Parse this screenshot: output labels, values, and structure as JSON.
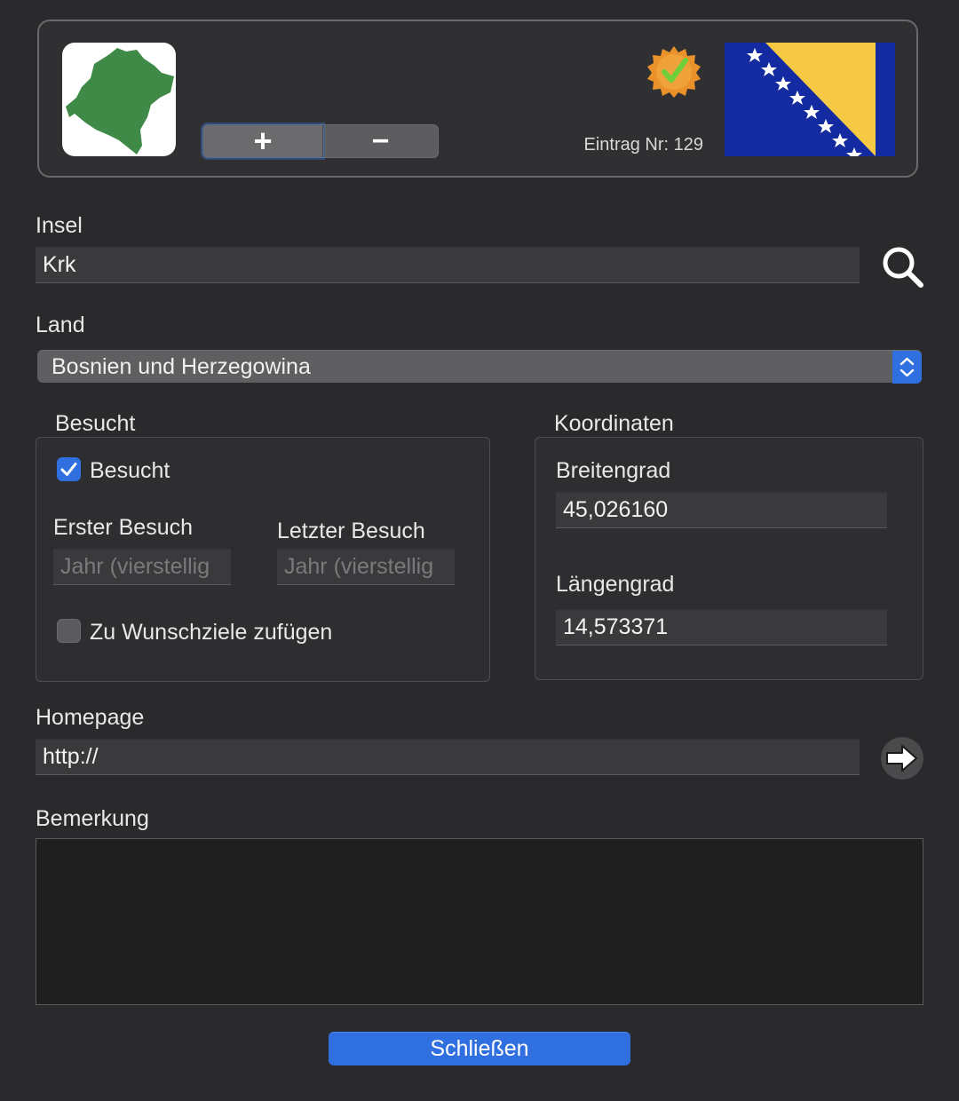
{
  "header": {
    "add_label": "+",
    "remove_label": "−",
    "entry_number": "Eintrag Nr: 129",
    "island_color": "#3f8a47",
    "flag_colors": {
      "blue": "#132aa0",
      "yellow": "#f6c945",
      "stars": "#ffffff"
    }
  },
  "island": {
    "label": "Insel",
    "value": "Krk"
  },
  "country": {
    "label": "Land",
    "selected": "Bosnien und Herzegowina"
  },
  "visited_group": {
    "title": "Besucht",
    "visited_checkbox_label": "Besucht",
    "visited_checked": true,
    "first_visit_label": "Erster Besuch",
    "first_visit_placeholder": "Jahr (vierstellig",
    "last_visit_label": "Letzter Besuch",
    "last_visit_placeholder": "Jahr (vierstellig",
    "wishlist_label": "Zu Wunschziele zufügen",
    "wishlist_checked": false
  },
  "coordinates_group": {
    "title": "Koordinaten",
    "latitude_label": "Breitengrad",
    "latitude_value": "45,026160",
    "longitude_label": "Längengrad",
    "longitude_value": "14,573371"
  },
  "homepage": {
    "label": "Homepage",
    "value": "http://"
  },
  "remarks": {
    "label": "Bemerkung",
    "value": ""
  },
  "footer": {
    "close_label": "Schließen"
  },
  "colors": {
    "accent": "#2f6fe0",
    "window_bg": "#2a2a2c",
    "field_bg": "#3a3a3c"
  },
  "icons": {
    "search": "magnifying-glass-icon",
    "open_url": "arrow-right-icon",
    "verified": "verified-badge-icon",
    "checkmark": "checkmark-icon"
  }
}
